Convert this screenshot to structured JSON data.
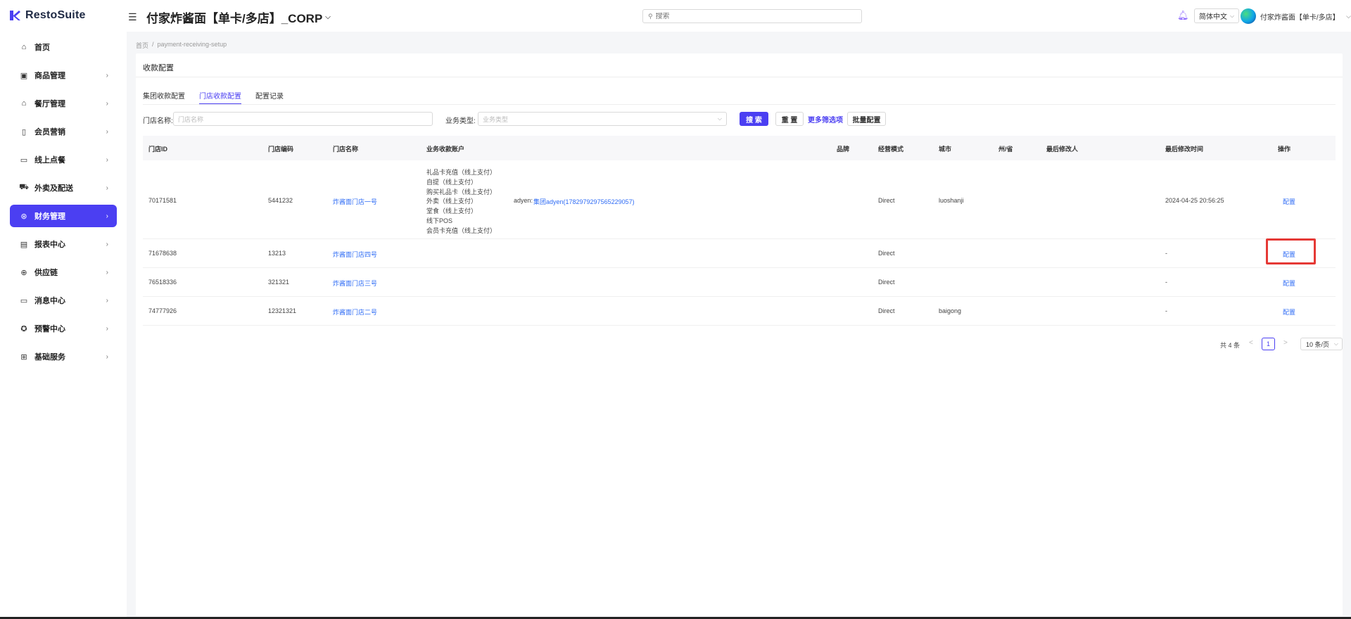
{
  "app": {
    "logo_text": "RestoSuite",
    "org_title": "付家炸酱面【单卡/多店】_CORP",
    "search_placeholder": "搜索",
    "language": "简体中文",
    "user_name": "付家炸酱面【单卡/多店】",
    "brand_color": "#4b3ff2"
  },
  "sidebar": {
    "items": [
      {
        "label": "首页",
        "icon": "home-icon",
        "has_arrow": false,
        "active": false
      },
      {
        "label": "商品管理",
        "icon": "product-icon",
        "has_arrow": true,
        "active": false
      },
      {
        "label": "餐厅管理",
        "icon": "restaurant-icon",
        "has_arrow": true,
        "active": false
      },
      {
        "label": "会员营销",
        "icon": "member-icon",
        "has_arrow": true,
        "active": false
      },
      {
        "label": "线上点餐",
        "icon": "online-order-icon",
        "has_arrow": true,
        "active": false
      },
      {
        "label": "外卖及配送",
        "icon": "delivery-icon",
        "has_arrow": true,
        "active": false
      },
      {
        "label": "财务管理",
        "icon": "finance-icon",
        "has_arrow": true,
        "active": true
      },
      {
        "label": "报表中心",
        "icon": "report-icon",
        "has_arrow": true,
        "active": false
      },
      {
        "label": "供应链",
        "icon": "supply-chain-icon",
        "has_arrow": true,
        "active": false
      },
      {
        "label": "消息中心",
        "icon": "message-icon",
        "has_arrow": true,
        "active": false
      },
      {
        "label": "预警中心",
        "icon": "alert-icon",
        "has_arrow": true,
        "active": false
      },
      {
        "label": "基础服务",
        "icon": "grid-icon",
        "has_arrow": true,
        "active": false
      }
    ]
  },
  "breadcrumb": {
    "home": "首页",
    "sep": "/",
    "current": "payment-receiving-setup"
  },
  "page": {
    "title": "收款配置"
  },
  "tabs": [
    {
      "label": "集团收款配置",
      "active": false
    },
    {
      "label": "门店收款配置",
      "active": true
    },
    {
      "label": "配置记录",
      "active": false
    }
  ],
  "filters": {
    "store_name_label": "门店名称:",
    "store_name_placeholder": "门店名称",
    "biz_type_label": "业务类型:",
    "biz_type_placeholder": "业务类型",
    "search_label": "搜 索",
    "reset_label": "重 置",
    "more_label": "更多筛选项",
    "batch_label": "批量配置"
  },
  "table": {
    "headers": [
      "门店ID",
      "门店编码",
      "门店名称",
      "业务收款账户",
      "品牌",
      "经营模式",
      "城市",
      "州/省",
      "最后修改人",
      "最后修改时间",
      "操作"
    ],
    "rows": [
      {
        "id": "70171581",
        "code": "5441232",
        "name": "炸酱面门店一号",
        "accounts": [
          "礼品卡充值（线上支付）",
          "自提（线上支付）",
          "购买礼品卡（线上支付）",
          "外卖（线上支付）",
          "堂食（线上支付）",
          "线下POS",
          "会员卡充值（线上支付）"
        ],
        "account_prefix": "adyen:",
        "account_link": "集团adyen(1782979297565229057)",
        "brand": "",
        "mode": "Direct",
        "city": "luoshanji",
        "province": "",
        "modifier": "",
        "modified_time": "2024-04-25 20:56:25",
        "action": "配置"
      },
      {
        "id": "71678638",
        "code": "13213",
        "name": "炸酱面门店四号",
        "brand": "",
        "mode": "Direct",
        "city": "",
        "province": "",
        "modifier": "",
        "modified_time": "-",
        "action": "配置"
      },
      {
        "id": "76518336",
        "code": "321321",
        "name": "炸酱面门店三号",
        "brand": "",
        "mode": "Direct",
        "city": "",
        "province": "",
        "modifier": "",
        "modified_time": "-",
        "action": "配置"
      },
      {
        "id": "74777926",
        "code": "12321321",
        "name": "炸酱面门店二号",
        "brand": "",
        "mode": "Direct",
        "city": "baigong",
        "province": "",
        "modifier": "",
        "modified_time": "-",
        "action": "配置"
      }
    ]
  },
  "pagination": {
    "total": "共 4 条",
    "prev": "<",
    "current": "1",
    "next": ">",
    "page_size": "10 条/页"
  }
}
